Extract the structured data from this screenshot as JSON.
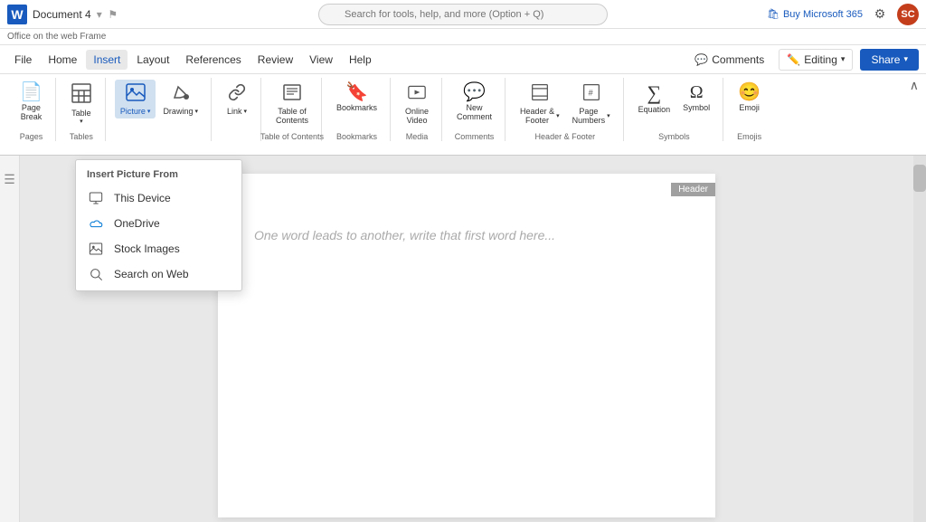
{
  "titleBar": {
    "logoText": "W",
    "docTitle": "Document 4",
    "searchPlaceholder": "Search for tools, help, and more (Option + Q)",
    "buyMs": "Buy Microsoft 365",
    "gearIcon": "⚙",
    "avatarText": "SC"
  },
  "appBar": {
    "text": "Office on the web Frame"
  },
  "menuBar": {
    "items": [
      "File",
      "Home",
      "Insert",
      "Layout",
      "References",
      "Review",
      "View",
      "Help"
    ],
    "activeItem": "Insert",
    "comments": "Comments",
    "editing": "Editing",
    "share": "Share"
  },
  "ribbon": {
    "groups": [
      {
        "label": "Pages",
        "buttons": [
          {
            "icon": "📄",
            "label": "Page\nBreak",
            "hasArrow": false
          }
        ]
      },
      {
        "label": "Tables",
        "buttons": [
          {
            "icon": "⊞",
            "label": "Table",
            "hasArrow": true
          }
        ]
      },
      {
        "label": "",
        "buttons": [
          {
            "icon": "🖼",
            "label": "Picture",
            "hasArrow": true,
            "active": true
          },
          {
            "icon": "✏️",
            "label": "Drawing",
            "hasArrow": true
          }
        ]
      },
      {
        "label": "",
        "buttons": [
          {
            "icon": "🔗",
            "label": "Link",
            "hasArrow": true
          }
        ]
      },
      {
        "label": "Table of Contents",
        "buttons": [
          {
            "icon": "☰",
            "label": "Table of\nContents",
            "hasArrow": false
          }
        ]
      },
      {
        "label": "Bookmarks",
        "buttons": [
          {
            "icon": "🔖",
            "label": "Bookmarks",
            "hasArrow": false
          }
        ]
      },
      {
        "label": "Media",
        "buttons": [
          {
            "icon": "▶",
            "label": "Online\nVideo",
            "hasArrow": false
          }
        ]
      },
      {
        "label": "Comments",
        "buttons": [
          {
            "icon": "💬",
            "label": "New\nComment",
            "hasArrow": false
          }
        ]
      },
      {
        "label": "Header & Footer",
        "buttons": [
          {
            "icon": "⬆",
            "label": "Header &\nFooter",
            "hasArrow": true
          },
          {
            "icon": "🔢",
            "label": "Page\nNumbers",
            "hasArrow": true
          }
        ]
      },
      {
        "label": "Symbols",
        "buttons": [
          {
            "icon": "∑",
            "label": "Equation",
            "hasArrow": false
          },
          {
            "icon": "Ω",
            "label": "Symbol",
            "hasArrow": false
          }
        ]
      },
      {
        "label": "Emojis",
        "buttons": [
          {
            "icon": "😊",
            "label": "Emoji",
            "hasArrow": false
          }
        ]
      }
    ],
    "collapseIcon": "∧"
  },
  "insertPictureDropdown": {
    "header": "Insert Picture From",
    "items": [
      {
        "icon": "💻",
        "label": "This Device"
      },
      {
        "icon": "☁",
        "label": "OneDrive"
      },
      {
        "icon": "🖼",
        "label": "Stock Images"
      },
      {
        "icon": "🔍",
        "label": "Search on Web"
      }
    ]
  },
  "document": {
    "headerLabel": "Header",
    "placeholderText": "One word leads to another, write that first word here..."
  }
}
